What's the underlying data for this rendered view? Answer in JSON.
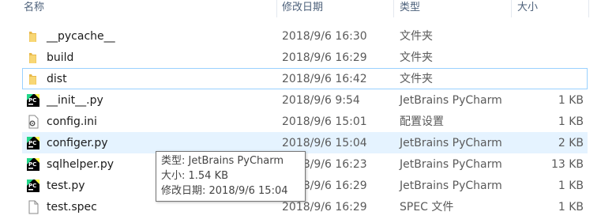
{
  "columns": {
    "name": "名称",
    "date": "修改日期",
    "type": "类型",
    "size": "大小"
  },
  "files": [
    {
      "name": "__pycache__",
      "date": "2018/9/6 16:30",
      "type": "文件夹",
      "size": "",
      "icon": "folder-icon"
    },
    {
      "name": "build",
      "date": "2018/9/6 16:29",
      "type": "文件夹",
      "size": "",
      "icon": "folder-icon"
    },
    {
      "name": "dist",
      "date": "2018/9/6 16:42",
      "type": "文件夹",
      "size": "",
      "icon": "folder-icon"
    },
    {
      "name": "__init__.py",
      "date": "2018/9/6 9:54",
      "type": "JetBrains PyCharm",
      "size": "1 KB",
      "icon": "pycharm-file-icon"
    },
    {
      "name": "config.ini",
      "date": "2018/9/6 15:01",
      "type": "配置设置",
      "size": "1 KB",
      "icon": "config-file-icon"
    },
    {
      "name": "configer.py",
      "date": "2018/9/6 15:04",
      "type": "JetBrains PyCharm",
      "size": "2 KB",
      "icon": "pycharm-file-icon"
    },
    {
      "name": "sqlhelper.py",
      "date": "2018/9/6 16:23",
      "type": "JetBrains PyCharm",
      "size": "13 KB",
      "icon": "pycharm-file-icon"
    },
    {
      "name": "test.py",
      "date": "2018/9/6 16:29",
      "type": "JetBrains PyCharm",
      "size": "1 KB",
      "icon": "pycharm-file-icon"
    },
    {
      "name": "test.spec",
      "date": "2018/9/6 16:29",
      "type": "SPEC 文件",
      "size": "1 KB",
      "icon": "blank-file-icon"
    }
  ],
  "tooltip": {
    "line1": "类型: JetBrains PyCharm",
    "line2": "大小: 1.54 KB",
    "line3": "修改日期: 2018/9/6 15:04"
  },
  "colors": {
    "hover": "#e5f3ff",
    "focus_border": "#99d1ff",
    "folder": "#f8d775",
    "pycharm_green": "#21d789"
  }
}
